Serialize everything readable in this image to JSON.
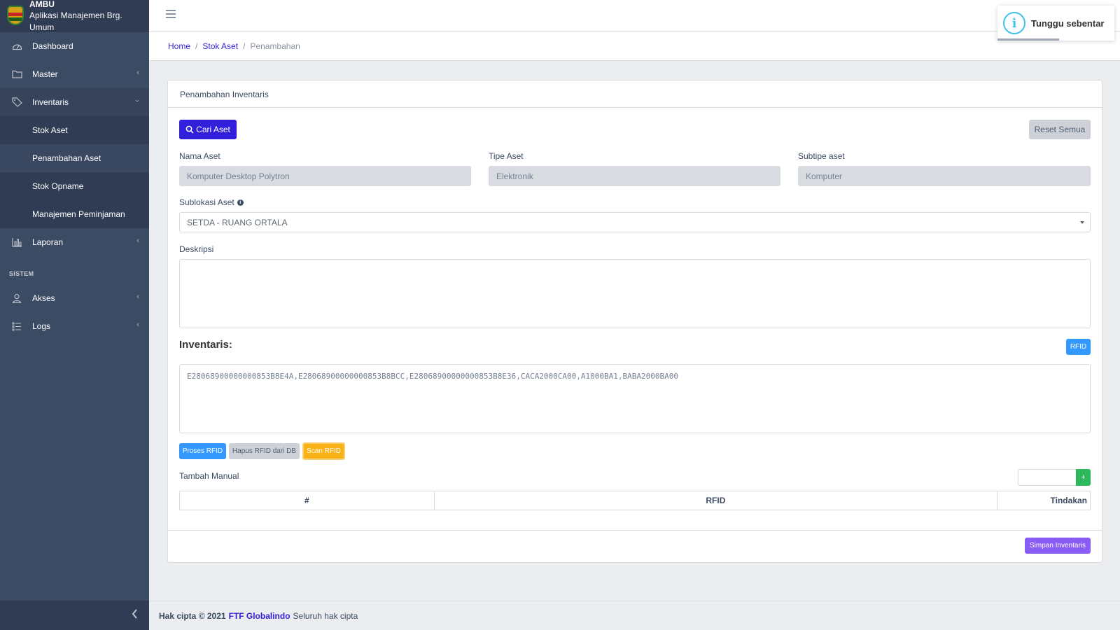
{
  "brand": {
    "title": "AMBU",
    "subtitle": "Aplikasi Manajemen Brg. Umum"
  },
  "sidebar": {
    "items": [
      {
        "label": "Dashboard",
        "icon": "speedometer-icon"
      },
      {
        "label": "Master",
        "icon": "folder-icon"
      },
      {
        "label": "Inventaris",
        "icon": "tag-icon"
      },
      {
        "label": "Laporan",
        "icon": "chart-icon"
      }
    ],
    "inventaris_sub": [
      "Stok Aset",
      "Penambahan Aset",
      "Stok Opname",
      "Manajemen Peminjaman"
    ],
    "section_title": "SISTEM",
    "system_items": [
      {
        "label": "Akses",
        "icon": "user-icon"
      },
      {
        "label": "Logs",
        "icon": "list-icon"
      }
    ]
  },
  "breadcrumb": {
    "home": "Home",
    "parent": "Stok Aset",
    "current": "Penambahan",
    "separator": "/"
  },
  "toast": {
    "text": "Tunggu sebentar",
    "icon": "info-icon"
  },
  "card": {
    "title": "Penambahan Inventaris",
    "search_button": "Cari Aset",
    "reset_button": "Reset Semua",
    "nama_label": "Nama Aset",
    "nama_value": "Komputer Desktop Polytron",
    "tipe_label": "Tipe Aset",
    "tipe_value": "Elektronik",
    "subtipe_label": "Subtipe aset",
    "subtipe_value": "Komputer",
    "sublokasi_label": "Sublokasi Aset",
    "sublokasi_value": "SETDA - RUANG ORTALA",
    "deskripsi_label": "Deskripsi",
    "deskripsi_value": "",
    "inventaris_heading": "Inventaris:",
    "rfid_button": "RFID",
    "rfid_values": "E28068900000000853B8E4A,E28068900000000853B8BCC,E28068900000000853B8E36,CACA2000CA00,A1000BA1,BABA2000BA00",
    "proses_button": "Proses RFID",
    "hapus_button": "Hapus RFID dari DB",
    "scan_button": "Scan RFID",
    "tambah_label": "Tambah Manual",
    "add_button": "+",
    "table_headers": [
      "#",
      "RFID",
      "Tindakan"
    ],
    "save_button": "Simpan Inventaris"
  },
  "footer": {
    "prefix": "Hak cipta © 2021",
    "company": "FTF Globalindo",
    "suffix": "Seluruh hak cipta"
  }
}
